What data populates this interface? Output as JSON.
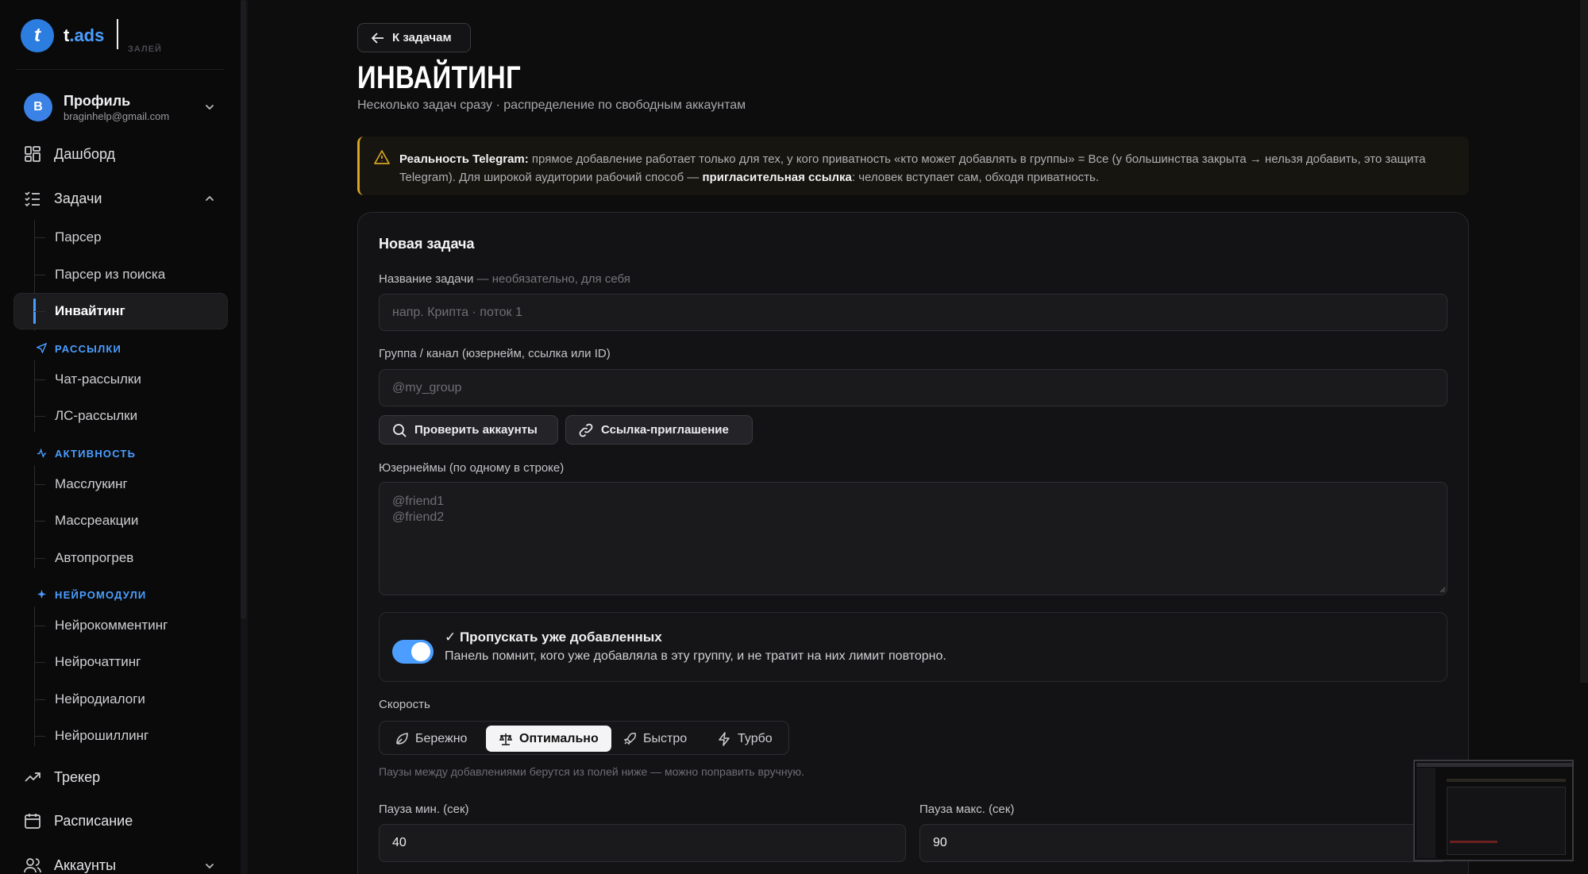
{
  "brand": {
    "name": "t",
    "name_accent": ".ads",
    "sub": "ЗАЛЕЙ"
  },
  "profile": {
    "initial": "B",
    "name": "Профиль",
    "email": "braginhelp@gmail.com"
  },
  "nav": {
    "dashboard": "Дашборд",
    "tasks": "Задачи",
    "tasks_items": [
      "Парсер",
      "Парсер из поиска",
      "Инвайтинг"
    ],
    "section_mailings": "РАССЫЛКИ",
    "mailings_items": [
      "Чат-рассылки",
      "ЛС-рассылки"
    ],
    "section_activity": "АКТИВНОСТЬ",
    "activity_items": [
      "Масслукинг",
      "Массреакции",
      "Автопрогрев"
    ],
    "section_neuro": "НЕЙРОМОДУЛИ",
    "neuro_items": [
      "Нейрокомментинг",
      "Нейрочаттинг",
      "Нейродиалоги",
      "Нейрошиллинг"
    ],
    "tracker": "Трекер",
    "schedule": "Расписание",
    "accounts": "Аккаунты"
  },
  "header": {
    "back": "К задачам",
    "title": "ИНВАЙТИНГ",
    "subtitle": "Несколько задач сразу · распределение по свободным аккаунтам"
  },
  "notice": {
    "bold1": "Реальность Telegram:",
    "text1": " прямое добавление работает только для тех, у кого приватность «кто может добавлять в группы» = Все (у большинства закрыта → нельзя добавить, это защита Telegram). Для широкой аудитории рабочий способ — ",
    "bold2": "пригласительная ссылка",
    "text2": ": человек вступает сам, обходя приватность."
  },
  "form": {
    "card_title": "Новая задача",
    "name_label": "Название задачи",
    "name_hint": " — необязательно, для себя",
    "name_placeholder": "напр. Крипта · поток 1",
    "group_label": "Группа / канал (юзернейм, ссылка или ID)",
    "group_placeholder": "@my_group",
    "check_btn": "Проверить аккаунты",
    "invite_btn": "Ссылка-приглашение",
    "users_label": "Юзернеймы (по одному в строке)",
    "users_placeholder_1": "@friend1",
    "users_placeholder_2": "@friend2",
    "skip_title": "✓ Пропускать уже добавленных",
    "skip_desc": "Панель помнит, кого уже добавляла в эту группу, и не тратит на них лимит повторно.",
    "skip_enabled": true,
    "speed_label": "Скорость",
    "speed_options": [
      "Бережно",
      "Оптимально",
      "Быстро",
      "Турбо"
    ],
    "speed_selected": "Оптимально",
    "speed_hint": "Паузы между добавлениями берутся из полей ниже — можно поправить вручную.",
    "pause_min_label": "Пауза мин. (сек)",
    "pause_min": "40",
    "pause_max_label": "Пауза макс. (сек)",
    "pause_max": "90"
  },
  "colors": {
    "accent": "#4b9eff",
    "warning": "#d9a324",
    "background": "#0d0d0e"
  }
}
